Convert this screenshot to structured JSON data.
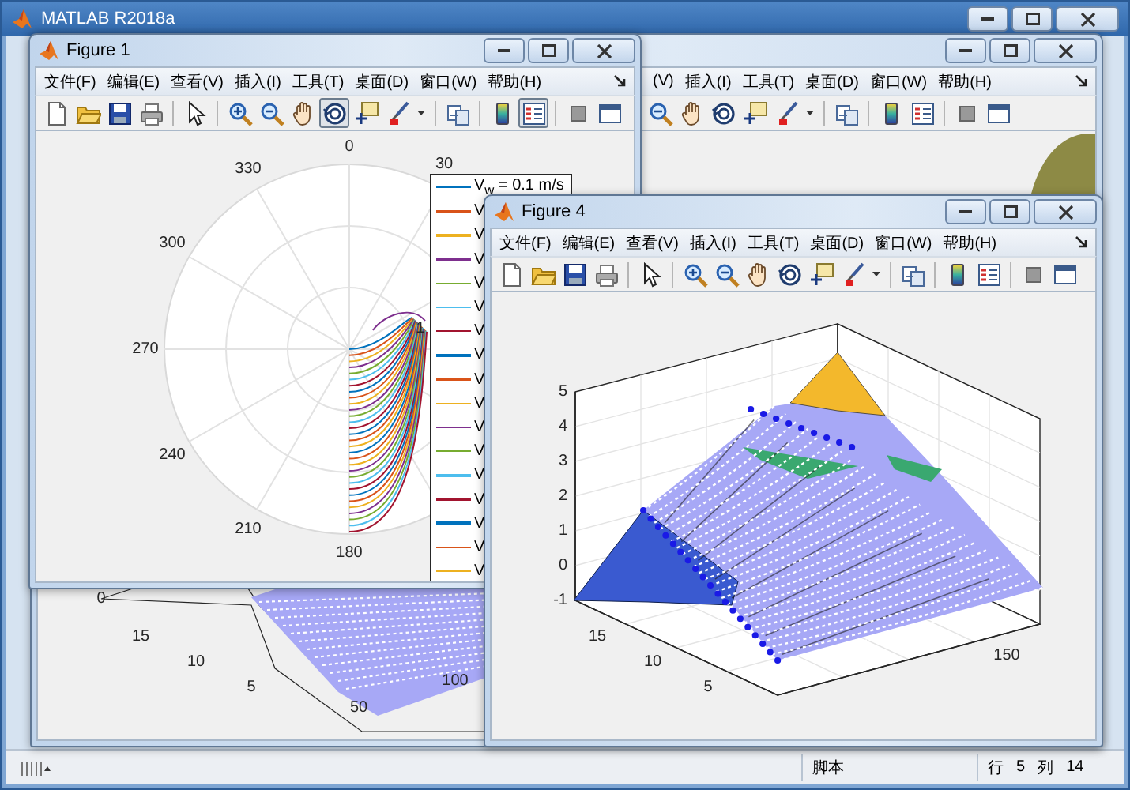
{
  "app": {
    "title": "MATLAB R2018a"
  },
  "background_figure": {
    "menu": [
      "(V)",
      "插入(I)",
      "工具(T)",
      "桌面(D)",
      "窗口(W)",
      "帮助(H)"
    ],
    "toolbar": [
      {
        "kind": "zoom-out",
        "selected": false
      },
      {
        "kind": "pan",
        "selected": false
      },
      {
        "kind": "rotate",
        "selected": false
      },
      {
        "kind": "datacursor",
        "selected": false
      },
      {
        "kind": "brush",
        "selected": false
      },
      {
        "kind": "caret",
        "selected": false
      },
      {
        "kind": "separator"
      },
      {
        "kind": "link",
        "selected": false
      },
      {
        "kind": "separator"
      },
      {
        "kind": "colorbar",
        "selected": false
      },
      {
        "kind": "legend",
        "selected": false
      },
      {
        "kind": "separator"
      },
      {
        "kind": "hide",
        "selected": false
      },
      {
        "kind": "dock",
        "selected": false
      }
    ],
    "plot": {
      "z_ticks": [
        "0"
      ],
      "y_ticks": [
        "15",
        "10",
        "5"
      ],
      "x_ticks": [
        "50",
        "100"
      ]
    }
  },
  "figures": [
    {
      "title": "Figure 1",
      "menu": [
        "文件(F)",
        "编辑(E)",
        "查看(V)",
        "插入(I)",
        "工具(T)",
        "桌面(D)",
        "窗口(W)",
        "帮助(H)"
      ],
      "toolbar": [
        {
          "kind": "new",
          "selected": false
        },
        {
          "kind": "open",
          "selected": false
        },
        {
          "kind": "save",
          "selected": false
        },
        {
          "kind": "print",
          "selected": false
        },
        {
          "kind": "separator"
        },
        {
          "kind": "pointer",
          "selected": false
        },
        {
          "kind": "separator"
        },
        {
          "kind": "zoom-in",
          "selected": false
        },
        {
          "kind": "zoom-out",
          "selected": false
        },
        {
          "kind": "pan",
          "selected": false
        },
        {
          "kind": "rotate",
          "selected": true
        },
        {
          "kind": "datacursor",
          "selected": false
        },
        {
          "kind": "brush",
          "selected": false
        },
        {
          "kind": "caret",
          "selected": false
        },
        {
          "kind": "separator"
        },
        {
          "kind": "link",
          "selected": false
        },
        {
          "kind": "separator"
        },
        {
          "kind": "colorbar",
          "selected": false
        },
        {
          "kind": "legend",
          "selected": true
        },
        {
          "kind": "separator"
        },
        {
          "kind": "hide",
          "selected": false
        },
        {
          "kind": "dock",
          "selected": false
        }
      ],
      "plot": {
        "kind": "polar",
        "angle_labels": [
          "0",
          "30",
          "180",
          "210",
          "240",
          "270",
          "300",
          "330"
        ],
        "radius_label": "1",
        "legend": [
          {
            "label": "V$_{w}$ = 0.1 m/s",
            "color": "#0072bd"
          },
          {
            "label": "V",
            "color": "#d95319"
          },
          {
            "label": "V",
            "color": "#edb120"
          },
          {
            "label": "V",
            "color": "#7e2f8e"
          },
          {
            "label": "V",
            "color": "#77ac30"
          },
          {
            "label": "V",
            "color": "#4dbeee"
          },
          {
            "label": "V",
            "color": "#a2142f"
          },
          {
            "label": "V",
            "color": "#0072bd"
          },
          {
            "label": "V",
            "color": "#d95319"
          },
          {
            "label": "V",
            "color": "#edb120"
          },
          {
            "label": "V",
            "color": "#7e2f8e"
          },
          {
            "label": "V",
            "color": "#77ac30"
          },
          {
            "label": "V",
            "color": "#4dbeee"
          },
          {
            "label": "V",
            "color": "#a2142f"
          },
          {
            "label": "V",
            "color": "#0072bd"
          },
          {
            "label": "V",
            "color": "#d95319"
          },
          {
            "label": "V",
            "color": "#edb120"
          }
        ]
      }
    },
    {
      "title": "Figure 4",
      "menu": [
        "文件(F)",
        "编辑(E)",
        "查看(V)",
        "插入(I)",
        "工具(T)",
        "桌面(D)",
        "窗口(W)",
        "帮助(H)"
      ],
      "toolbar": [
        {
          "kind": "new",
          "selected": false
        },
        {
          "kind": "open",
          "selected": false
        },
        {
          "kind": "save",
          "selected": false
        },
        {
          "kind": "print",
          "selected": false
        },
        {
          "kind": "separator"
        },
        {
          "kind": "pointer",
          "selected": false
        },
        {
          "kind": "separator"
        },
        {
          "kind": "zoom-in",
          "selected": false
        },
        {
          "kind": "zoom-out",
          "selected": false
        },
        {
          "kind": "pan",
          "selected": false
        },
        {
          "kind": "rotate",
          "selected": false
        },
        {
          "kind": "datacursor",
          "selected": false
        },
        {
          "kind": "brush",
          "selected": false
        },
        {
          "kind": "caret",
          "selected": false
        },
        {
          "kind": "separator"
        },
        {
          "kind": "link",
          "selected": false
        },
        {
          "kind": "separator"
        },
        {
          "kind": "colorbar",
          "selected": false
        },
        {
          "kind": "legend",
          "selected": false
        },
        {
          "kind": "separator"
        },
        {
          "kind": "hide",
          "selected": false
        },
        {
          "kind": "dock",
          "selected": false
        }
      ],
      "plot": {
        "kind": "surface3d",
        "z_ticks": [
          "5",
          "4",
          "3",
          "2",
          "1",
          "0",
          "-1"
        ],
        "y_ticks": [
          "15",
          "10",
          "5"
        ],
        "x_ticks": [
          "150"
        ]
      }
    }
  ],
  "status_bar": {
    "mode": "脚本",
    "row_label": "行",
    "row": "5",
    "col_label": "列",
    "col": "14"
  }
}
